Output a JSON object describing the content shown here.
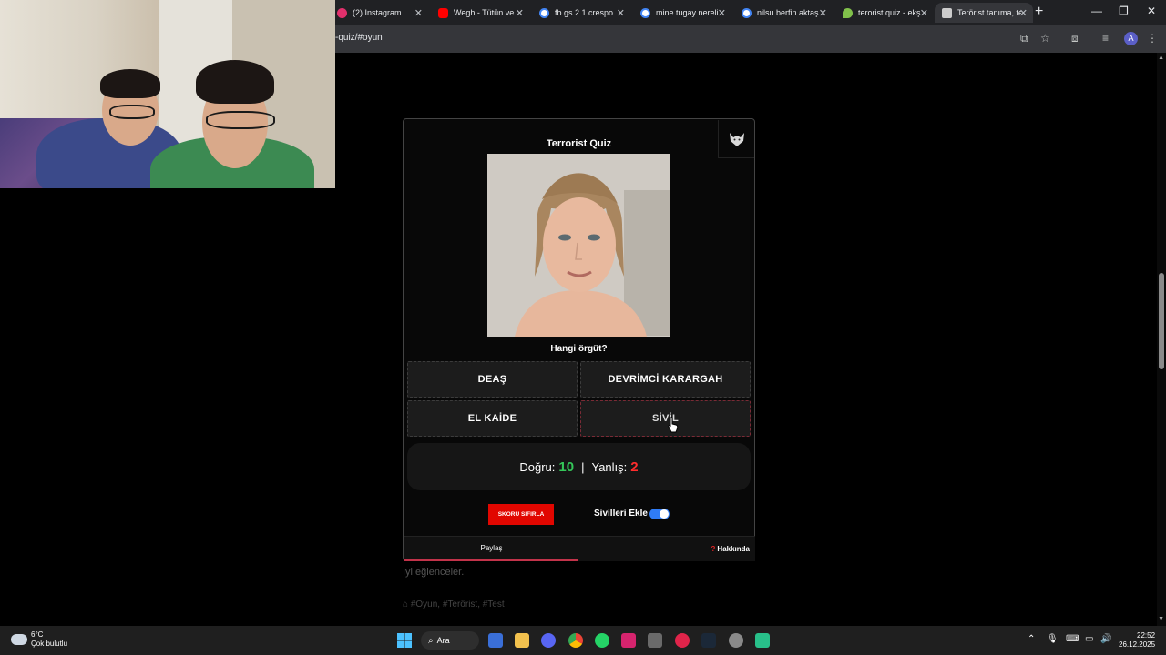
{
  "browser": {
    "tabs": [
      {
        "label": "(2) Instagram",
        "icon": "instagram-icon",
        "color": "#e1306c"
      },
      {
        "label": "Wegh - Tütün ve",
        "icon": "youtube-icon",
        "color": "#ff0000"
      },
      {
        "label": "fb gs 2 1 crespo",
        "icon": "google-icon",
        "color": "#ffffff"
      },
      {
        "label": "mine tugay nereli",
        "icon": "google-icon",
        "color": "#ffffff"
      },
      {
        "label": "nilsu berfin aktaş",
        "icon": "google-icon",
        "color": "#ffffff"
      },
      {
        "label": "terorist quiz - ekş",
        "icon": "eksi-drop-icon",
        "color": "#81c14b"
      },
      {
        "label": "Terörist tanıma, te",
        "icon": "wikipedia-icon",
        "color": "#cccccc"
      }
    ],
    "url": "-quiz/#oyun"
  },
  "quiz": {
    "title": "Terrorist Quiz",
    "question": "Hangi örgüt?",
    "options": [
      "DEAŞ",
      "DEVRİMCİ KARARGAH",
      "EL KAİDE",
      "SİVİL"
    ],
    "selected_option": "SİVİL",
    "score": {
      "correct_label": "Doğru:",
      "correct": "10",
      "separator": "|",
      "wrong_label": "Yanlış:",
      "wrong": "2"
    },
    "reset_label": "SKORU SIFIRLA",
    "toggle_label": "Sivilleri Ekle",
    "toggle_on": true,
    "share_label": "Paylaş",
    "about_label": "Hakkında",
    "about_icon": "question-icon"
  },
  "page": {
    "footer_text": "İyi eğlenceler.",
    "tags": "#Oyun, #Terörist, #Test"
  },
  "taskbar": {
    "weather_temp": "6°C",
    "weather_desc": "Çok bulutlu",
    "search_label": "Ara",
    "time": "22:52",
    "date": "26.12.2025"
  },
  "colors": {
    "accent": "#c2334a",
    "correct": "#34c759",
    "wrong": "#ff2d2d",
    "reset_button": "#e10600",
    "toggle": "#2f7cf6"
  }
}
